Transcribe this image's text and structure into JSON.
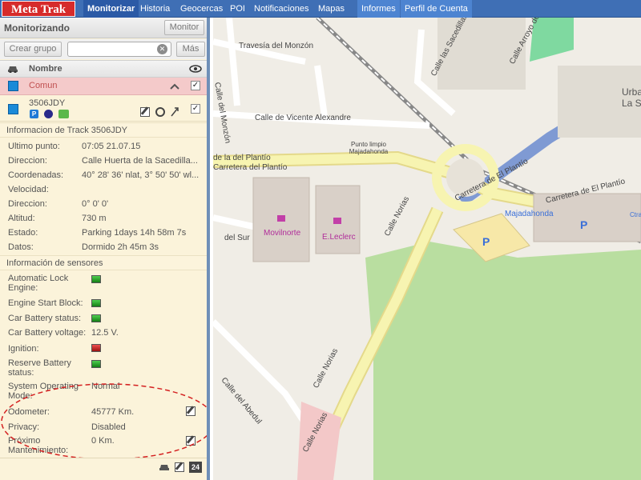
{
  "brand": {
    "logo_text": "Meta Trak"
  },
  "nav": {
    "items": [
      "Monitorizar",
      "Historia",
      "Geocercas",
      "POI",
      "Notificaciones",
      "Mapas",
      "Informes",
      "Perfil de Cuenta"
    ]
  },
  "panel": {
    "title": "Monitorizando",
    "monitor_button": "Monitor",
    "create_group_button": "Crear grupo",
    "search_value": "",
    "more_button": "Más",
    "column_name": "Nombre"
  },
  "group": {
    "name": "Comun",
    "checked": "✓"
  },
  "vehicle": {
    "name": "3506JDY",
    "checked": "✓"
  },
  "track_info": {
    "title": "Informacion de Track 3506JDY",
    "rows": [
      {
        "label": "Ultimo punto:",
        "value": "07:05 21.07.15"
      },
      {
        "label": "Direccion:",
        "value": "Calle Huerta de la Sacedilla..."
      },
      {
        "label": "Coordenadas:",
        "value": "40° 28' 36' nlat, 3° 50' 50' wl..."
      },
      {
        "label": "Velocidad:",
        "value": ""
      },
      {
        "label": "Direccion:",
        "value": "0° 0' 0'"
      },
      {
        "label": "Altitud:",
        "value": "730 m"
      },
      {
        "label": "Estado:",
        "value": "Parking 1days 14h 58m 7s"
      },
      {
        "label": "Datos:",
        "value": "Dormido 2h 45m 3s"
      }
    ]
  },
  "sensors": {
    "title": "Información de sensores",
    "items": [
      {
        "label": "Automatic Lock Engine:",
        "status": "green"
      },
      {
        "label": "Engine Start Block:",
        "status": "green"
      },
      {
        "label": "Car Battery status:",
        "status": "green"
      },
      {
        "label": "Car Battery voltage:",
        "value": "12.5 V."
      },
      {
        "label": "Ignition:",
        "status": "red"
      },
      {
        "label": "Reserve Battery status:",
        "status": "green"
      },
      {
        "label": "System Operating Mode:",
        "value": "Normal"
      },
      {
        "label": "Odometer:",
        "value": "45777 Km."
      },
      {
        "label": "Privacy:",
        "value": "Disabled"
      },
      {
        "label": "Próximo Mantenimiento:",
        "value": "0 Km."
      }
    ]
  },
  "map": {
    "labels": {
      "travesia": "Travesía del Monzón",
      "calle_monzon": "Calle del Monzón",
      "vicente": "Calle de Vicente Alexandre",
      "punto_limpio": "Punto limpio Majadahonda",
      "plantio1": "de la del Plantío",
      "plantio2": "Carretera del Plantío",
      "movilnorte": "Movilnorte",
      "eleclerc": "E.Leclerc",
      "sur": "del Sur",
      "norias1": "Calle Norias",
      "norias2": "Calle Norias",
      "norias3": "Calle Norias",
      "abedul": "Calle del Abedul",
      "carretera_plantio": "Carretera de El Plantío",
      "carretera2": "Carretera de El Plantío",
      "majadahonda": "Majadahonda",
      "sacedillas": "Calle las Sacedillas",
      "arroyo": "Calle Arroyo de",
      "urba": "Urba",
      "las": "La S",
      "ctra": "Ctra"
    },
    "colors": {
      "road_major": "#f7f4b1",
      "park": "#b9dea0",
      "water": "#6fb3e6"
    }
  }
}
